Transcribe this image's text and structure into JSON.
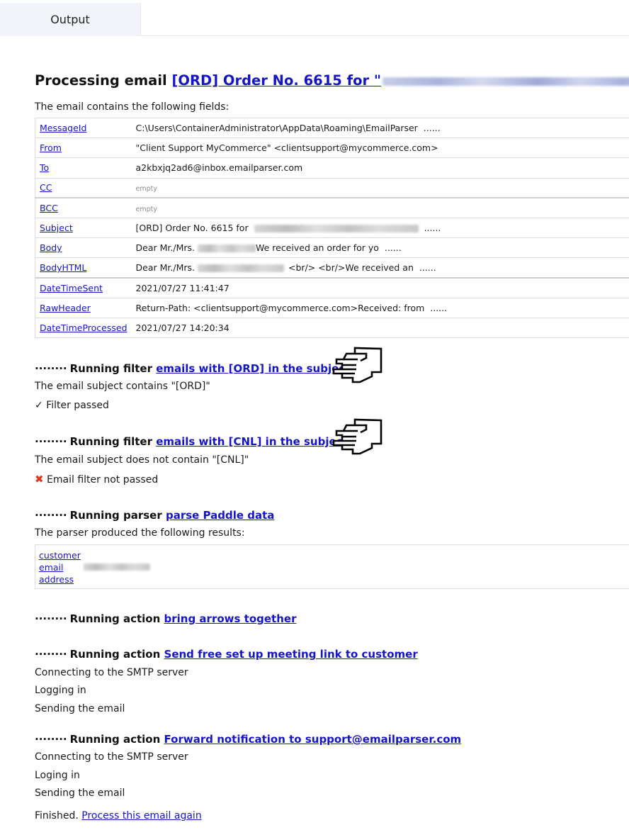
{
  "tabs": [
    {
      "label": "Output",
      "active": true
    }
  ],
  "header": {
    "prefix": "Processing email",
    "link_text": "[ORD] Order No. 6615 for \""
  },
  "intro": "The email contains the following fields:",
  "fields": [
    {
      "name": "MessageId",
      "value": "C:\\Users\\ContainerAdministrator\\AppData\\Roaming\\EmailParser",
      "more": "......"
    },
    {
      "name": "From",
      "value": "\"Client Support MyCommerce\" <clientsupport@mycommerce.com>",
      "more": ""
    },
    {
      "name": "To",
      "value": "a2kbxjq2ad6@inbox.emailparser.com",
      "more": ""
    },
    {
      "name": "CC",
      "value": "empty",
      "more": "",
      "empty": true
    },
    {
      "name": "BCC",
      "value": "empty",
      "more": "",
      "empty": true
    },
    {
      "name": "Subject",
      "value": "[ORD] Order No. 6615 for",
      "more": "......",
      "redacted": true
    },
    {
      "name": "Body",
      "value": "Dear Mr./Mrs.",
      "value_after": "We received an order for yo",
      "more": "......",
      "redacted": true
    },
    {
      "name": "BodyHTML",
      "value": "Dear Mr./Mrs.",
      "value_after": "<br/> <br/>We received an",
      "more": "......",
      "redacted": true
    },
    {
      "name": "DateTimeSent",
      "value": "2021/07/27 11:41:47",
      "more": ""
    },
    {
      "name": "RawHeader",
      "value": "Return-Path: <clientsupport@mycommerce.com>Received: from",
      "more": "......"
    },
    {
      "name": "DateTimeProcessed",
      "value": "2021/07/27 14:20:34",
      "more": ""
    }
  ],
  "steps": {
    "dots": "········",
    "filter1": {
      "label": "Running filter",
      "link": "emails with [ORD] in the subject",
      "detail": "The email subject contains \"[ORD]\"",
      "status_icon": "check-icon",
      "status_glyph": "✓",
      "status": "Filter passed"
    },
    "filter2": {
      "label": "Running filter",
      "link": "emails with [CNL] in the subject",
      "detail": "The email subject does not contain \"[CNL]\"",
      "status_icon": "cross-icon",
      "status_glyph": "✖",
      "status": "Email filter not passed"
    },
    "parser": {
      "label": "Running parser",
      "link": "parse Paddle data",
      "detail": "The parser produced the following results:",
      "results": [
        "customer",
        "email",
        "address"
      ]
    },
    "action1": {
      "label": "Running action",
      "link": "bring arrows together"
    },
    "action2": {
      "label": "Running action",
      "link": "Send free set up meeting link to customer",
      "lines": [
        "Connecting to the SMTP server",
        "Logging in",
        "Sending the email"
      ]
    },
    "action3": {
      "label": "Running action",
      "link": "Forward notification to support@emailparser.com",
      "lines": [
        "Connecting to the SMTP server",
        "Loging in",
        "Sending the email"
      ]
    }
  },
  "footer": {
    "finished": "Finished.",
    "link": "Process this email again"
  },
  "colors": {
    "link": "#1515c8",
    "error": "#d93a1e",
    "tab_bg": "#f1f4f9"
  }
}
